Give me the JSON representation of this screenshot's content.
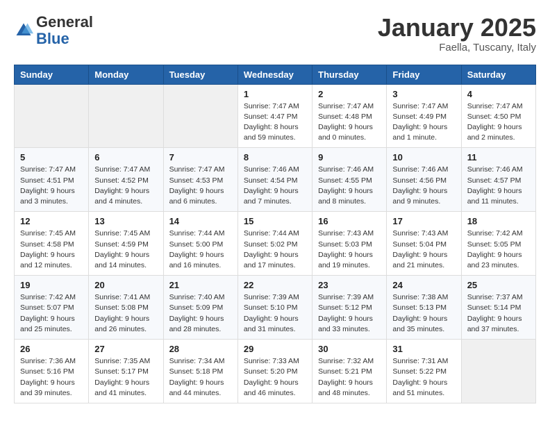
{
  "logo": {
    "general": "General",
    "blue": "Blue"
  },
  "header": {
    "month": "January 2025",
    "location": "Faella, Tuscany, Italy"
  },
  "weekdays": [
    "Sunday",
    "Monday",
    "Tuesday",
    "Wednesday",
    "Thursday",
    "Friday",
    "Saturday"
  ],
  "weeks": [
    [
      {
        "day": "",
        "sunrise": "",
        "sunset": "",
        "daylight": ""
      },
      {
        "day": "",
        "sunrise": "",
        "sunset": "",
        "daylight": ""
      },
      {
        "day": "",
        "sunrise": "",
        "sunset": "",
        "daylight": ""
      },
      {
        "day": "1",
        "sunrise": "Sunrise: 7:47 AM",
        "sunset": "Sunset: 4:47 PM",
        "daylight": "Daylight: 8 hours and 59 minutes."
      },
      {
        "day": "2",
        "sunrise": "Sunrise: 7:47 AM",
        "sunset": "Sunset: 4:48 PM",
        "daylight": "Daylight: 9 hours and 0 minutes."
      },
      {
        "day": "3",
        "sunrise": "Sunrise: 7:47 AM",
        "sunset": "Sunset: 4:49 PM",
        "daylight": "Daylight: 9 hours and 1 minute."
      },
      {
        "day": "4",
        "sunrise": "Sunrise: 7:47 AM",
        "sunset": "Sunset: 4:50 PM",
        "daylight": "Daylight: 9 hours and 2 minutes."
      }
    ],
    [
      {
        "day": "5",
        "sunrise": "Sunrise: 7:47 AM",
        "sunset": "Sunset: 4:51 PM",
        "daylight": "Daylight: 9 hours and 3 minutes."
      },
      {
        "day": "6",
        "sunrise": "Sunrise: 7:47 AM",
        "sunset": "Sunset: 4:52 PM",
        "daylight": "Daylight: 9 hours and 4 minutes."
      },
      {
        "day": "7",
        "sunrise": "Sunrise: 7:47 AM",
        "sunset": "Sunset: 4:53 PM",
        "daylight": "Daylight: 9 hours and 6 minutes."
      },
      {
        "day": "8",
        "sunrise": "Sunrise: 7:46 AM",
        "sunset": "Sunset: 4:54 PM",
        "daylight": "Daylight: 9 hours and 7 minutes."
      },
      {
        "day": "9",
        "sunrise": "Sunrise: 7:46 AM",
        "sunset": "Sunset: 4:55 PM",
        "daylight": "Daylight: 9 hours and 8 minutes."
      },
      {
        "day": "10",
        "sunrise": "Sunrise: 7:46 AM",
        "sunset": "Sunset: 4:56 PM",
        "daylight": "Daylight: 9 hours and 9 minutes."
      },
      {
        "day": "11",
        "sunrise": "Sunrise: 7:46 AM",
        "sunset": "Sunset: 4:57 PM",
        "daylight": "Daylight: 9 hours and 11 minutes."
      }
    ],
    [
      {
        "day": "12",
        "sunrise": "Sunrise: 7:45 AM",
        "sunset": "Sunset: 4:58 PM",
        "daylight": "Daylight: 9 hours and 12 minutes."
      },
      {
        "day": "13",
        "sunrise": "Sunrise: 7:45 AM",
        "sunset": "Sunset: 4:59 PM",
        "daylight": "Daylight: 9 hours and 14 minutes."
      },
      {
        "day": "14",
        "sunrise": "Sunrise: 7:44 AM",
        "sunset": "Sunset: 5:00 PM",
        "daylight": "Daylight: 9 hours and 16 minutes."
      },
      {
        "day": "15",
        "sunrise": "Sunrise: 7:44 AM",
        "sunset": "Sunset: 5:02 PM",
        "daylight": "Daylight: 9 hours and 17 minutes."
      },
      {
        "day": "16",
        "sunrise": "Sunrise: 7:43 AM",
        "sunset": "Sunset: 5:03 PM",
        "daylight": "Daylight: 9 hours and 19 minutes."
      },
      {
        "day": "17",
        "sunrise": "Sunrise: 7:43 AM",
        "sunset": "Sunset: 5:04 PM",
        "daylight": "Daylight: 9 hours and 21 minutes."
      },
      {
        "day": "18",
        "sunrise": "Sunrise: 7:42 AM",
        "sunset": "Sunset: 5:05 PM",
        "daylight": "Daylight: 9 hours and 23 minutes."
      }
    ],
    [
      {
        "day": "19",
        "sunrise": "Sunrise: 7:42 AM",
        "sunset": "Sunset: 5:07 PM",
        "daylight": "Daylight: 9 hours and 25 minutes."
      },
      {
        "day": "20",
        "sunrise": "Sunrise: 7:41 AM",
        "sunset": "Sunset: 5:08 PM",
        "daylight": "Daylight: 9 hours and 26 minutes."
      },
      {
        "day": "21",
        "sunrise": "Sunrise: 7:40 AM",
        "sunset": "Sunset: 5:09 PM",
        "daylight": "Daylight: 9 hours and 28 minutes."
      },
      {
        "day": "22",
        "sunrise": "Sunrise: 7:39 AM",
        "sunset": "Sunset: 5:10 PM",
        "daylight": "Daylight: 9 hours and 31 minutes."
      },
      {
        "day": "23",
        "sunrise": "Sunrise: 7:39 AM",
        "sunset": "Sunset: 5:12 PM",
        "daylight": "Daylight: 9 hours and 33 minutes."
      },
      {
        "day": "24",
        "sunrise": "Sunrise: 7:38 AM",
        "sunset": "Sunset: 5:13 PM",
        "daylight": "Daylight: 9 hours and 35 minutes."
      },
      {
        "day": "25",
        "sunrise": "Sunrise: 7:37 AM",
        "sunset": "Sunset: 5:14 PM",
        "daylight": "Daylight: 9 hours and 37 minutes."
      }
    ],
    [
      {
        "day": "26",
        "sunrise": "Sunrise: 7:36 AM",
        "sunset": "Sunset: 5:16 PM",
        "daylight": "Daylight: 9 hours and 39 minutes."
      },
      {
        "day": "27",
        "sunrise": "Sunrise: 7:35 AM",
        "sunset": "Sunset: 5:17 PM",
        "daylight": "Daylight: 9 hours and 41 minutes."
      },
      {
        "day": "28",
        "sunrise": "Sunrise: 7:34 AM",
        "sunset": "Sunset: 5:18 PM",
        "daylight": "Daylight: 9 hours and 44 minutes."
      },
      {
        "day": "29",
        "sunrise": "Sunrise: 7:33 AM",
        "sunset": "Sunset: 5:20 PM",
        "daylight": "Daylight: 9 hours and 46 minutes."
      },
      {
        "day": "30",
        "sunrise": "Sunrise: 7:32 AM",
        "sunset": "Sunset: 5:21 PM",
        "daylight": "Daylight: 9 hours and 48 minutes."
      },
      {
        "day": "31",
        "sunrise": "Sunrise: 7:31 AM",
        "sunset": "Sunset: 5:22 PM",
        "daylight": "Daylight: 9 hours and 51 minutes."
      },
      {
        "day": "",
        "sunrise": "",
        "sunset": "",
        "daylight": ""
      }
    ]
  ]
}
